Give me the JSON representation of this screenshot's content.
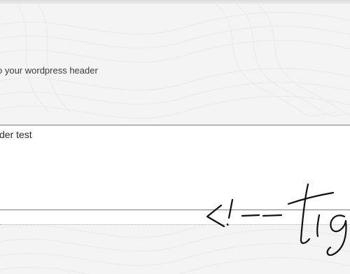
{
  "instruction": {
    "text": "o your wordpress header"
  },
  "header_field": {
    "value": "der test"
  },
  "signature": {
    "text": "<!--tig"
  }
}
